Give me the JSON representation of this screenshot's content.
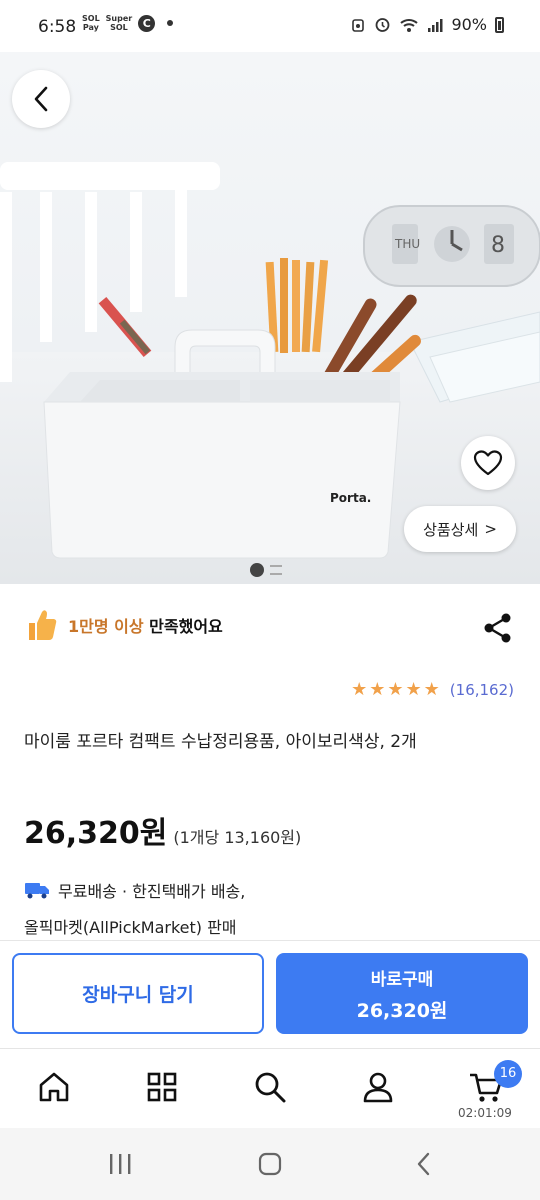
{
  "status_bar": {
    "time": "6:58",
    "app_icons": [
      "SOL Pay",
      "Super SOL"
    ],
    "c_icon_letter": "C",
    "battery": "90%"
  },
  "hero": {
    "brand_label": "Porta.",
    "clock_display": "THU 8",
    "detail_label": "상품상세",
    "detail_chevron": ">",
    "image_index": 1,
    "image_count": 2
  },
  "satisfaction": {
    "highlight": "1만명 이상",
    "rest": " 만족했어요"
  },
  "rating": {
    "stars": 5,
    "count": "(16,162)"
  },
  "product": {
    "title": "마이룸 포르타 컴팩트 수납정리용품, 아이보리색상, 2개",
    "price": "26,320원",
    "unit_price": "(1개당 13,160원)",
    "shipping": "무료배송 · 한진택배가 배송,",
    "seller": "올픽마켓(AllPickMarket) 판매"
  },
  "actions": {
    "cart_label": "장바구니 담기",
    "buy_label": "바로구매",
    "buy_price": "26,320원"
  },
  "bottom_nav": {
    "cart_badge": "16",
    "clock": "02:01:09"
  },
  "colors": {
    "accent": "#3d7bf2",
    "highlight": "#c8762a",
    "star": "#f1a14a",
    "rating_count": "#5a6bd1"
  }
}
